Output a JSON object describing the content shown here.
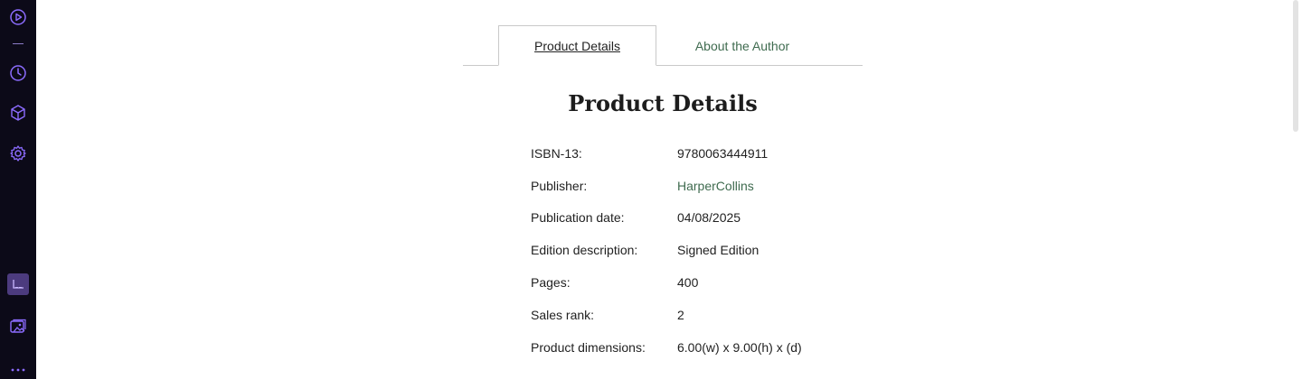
{
  "tabs": {
    "active_label": "Product Details",
    "inactive_label": "About the Author"
  },
  "heading": "Product Details",
  "details": [
    {
      "label": "ISBN-13:",
      "value": "9780063444911"
    },
    {
      "label": "Publisher:",
      "value": "HarperCollins",
      "link": true
    },
    {
      "label": "Publication date:",
      "value": "04/08/2025"
    },
    {
      "label": "Edition description:",
      "value": "Signed Edition"
    },
    {
      "label": "Pages:",
      "value": "400"
    },
    {
      "label": "Sales rank:",
      "value": "2"
    },
    {
      "label": "Product dimensions:",
      "value": "6.00(w) x 9.00(h) x (d)"
    }
  ],
  "colors": {
    "sidebar_bg": "#0c0a18",
    "sidebar_icon": "#8c6cff",
    "link_green": "#3f6b4f"
  },
  "sidebar_icons": [
    "play-circle-icon",
    "clock-icon",
    "cube-icon",
    "gear-icon",
    "chart-icon",
    "images-icon",
    "more-icon"
  ]
}
